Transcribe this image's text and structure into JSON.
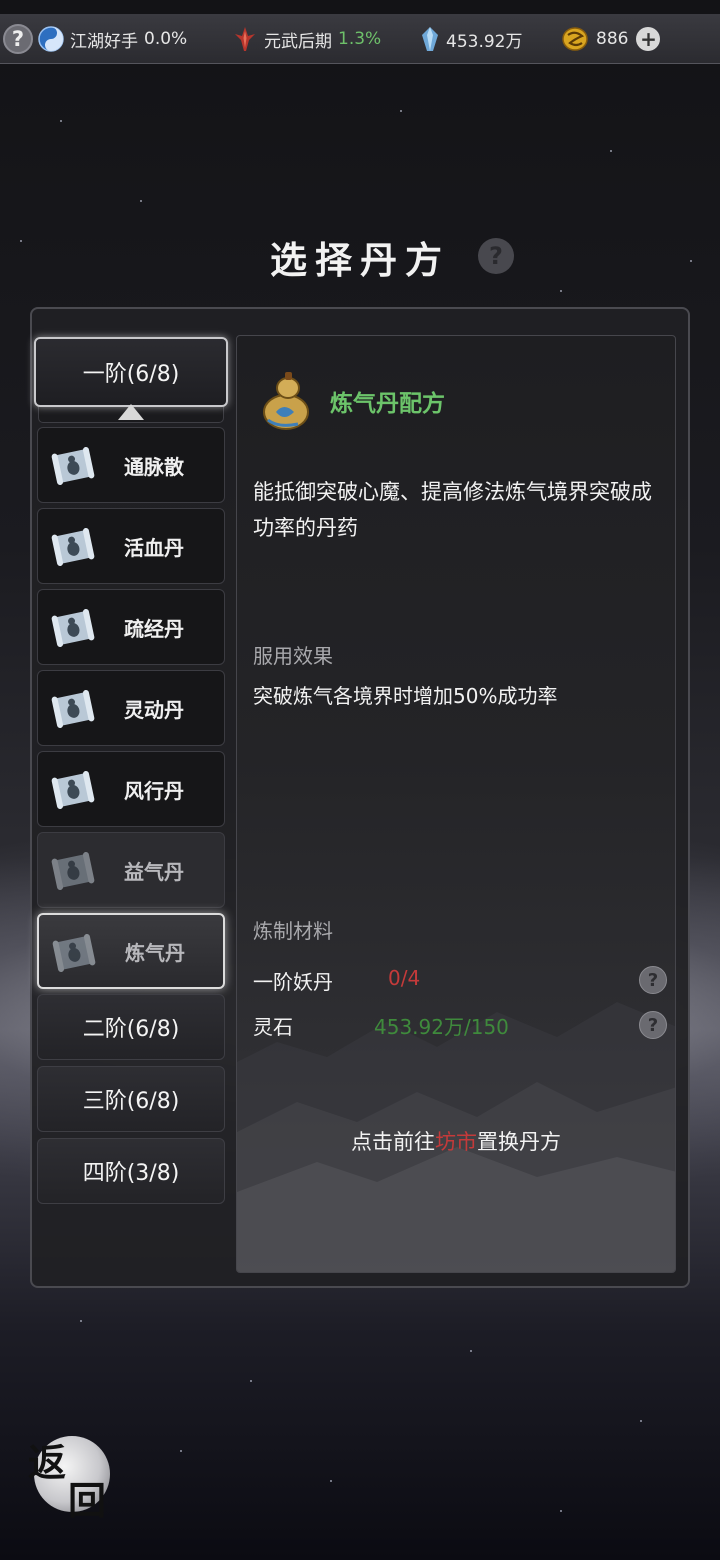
{
  "topbar": {
    "help_icon": "question-icon",
    "rank_icon": "yin-yang-icon",
    "rank_label": "江湖好手",
    "rank_progress": "0.0%",
    "realm_icon": "flame-sword-icon",
    "realm_label": "元武后期",
    "realm_progress": "1.3%",
    "spirit_stone_icon": "crystal-icon",
    "spirit_stone_value": "453.92万",
    "gold_icon": "gold-coin-icon",
    "gold_value": "886",
    "add_icon": "plus-icon"
  },
  "header": {
    "title": "选择丹方",
    "help_icon": "question-icon"
  },
  "tiers": {
    "selected": "一阶(6/8)",
    "others": [
      "二阶(6/8)",
      "三阶(6/8)",
      "四阶(3/8)"
    ]
  },
  "recipes": [
    {
      "name": "通脉散",
      "state": "available"
    },
    {
      "name": "活血丹",
      "state": "available"
    },
    {
      "name": "疏经丹",
      "state": "available"
    },
    {
      "name": "灵动丹",
      "state": "available"
    },
    {
      "name": "风行丹",
      "state": "available"
    },
    {
      "name": "益气丹",
      "state": "locked"
    },
    {
      "name": "炼气丹",
      "state": "selected"
    }
  ],
  "detail": {
    "name": "炼气丹配方",
    "icon": "gourd-icon",
    "description": "能抵御突破心魔、提高修法炼气境界突破成功率的丹药",
    "effect_label": "服用效果",
    "effect": "突破炼气各境界时增加50%成功率",
    "materials_label": "炼制材料",
    "materials": [
      {
        "name": "一阶妖丹",
        "amount": "0/4",
        "status_color": "#c43a3a"
      },
      {
        "name": "灵石",
        "amount": "453.92万/150",
        "status_color": "#3f8a3c"
      }
    ],
    "link_prefix": "点击前往",
    "link_market": "坊市",
    "link_suffix": "置换丹方"
  },
  "footer": {
    "back_char_1": "返",
    "back_char_2": "回"
  }
}
